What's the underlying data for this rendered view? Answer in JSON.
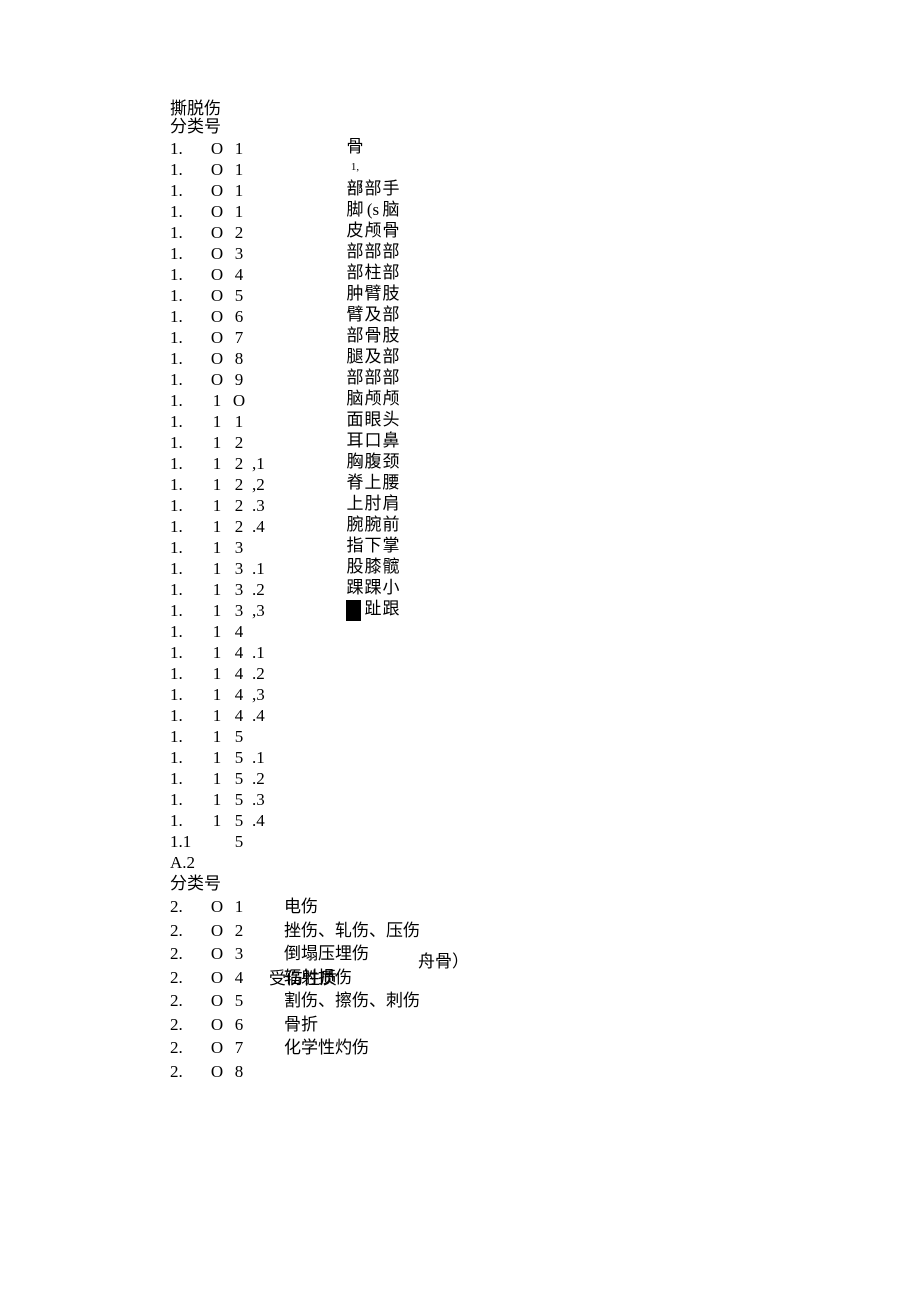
{
  "top": {
    "l1": "撕脱伤",
    "l2": "分类号"
  },
  "rows1": [
    {
      "a": "1.",
      "b": "O",
      "c": "1",
      "d": ""
    },
    {
      "a": "1.",
      "b": "O",
      "c": "1",
      "d": ""
    },
    {
      "a": "1.",
      "b": "O",
      "c": "1",
      "d": ""
    },
    {
      "a": "1.",
      "b": "O",
      "c": "1",
      "d": ""
    },
    {
      "a": "1.",
      "b": "O",
      "c": "2",
      "d": ""
    },
    {
      "a": "1.",
      "b": "O",
      "c": "3",
      "d": ""
    },
    {
      "a": "1.",
      "b": "O",
      "c": "4",
      "d": ""
    },
    {
      "a": "1.",
      "b": "O",
      "c": "5",
      "d": ""
    },
    {
      "a": "1.",
      "b": "O",
      "c": "6",
      "d": ""
    },
    {
      "a": "1.",
      "b": "O",
      "c": "7",
      "d": ""
    },
    {
      "a": "1.",
      "b": "O",
      "c": "8",
      "d": ""
    },
    {
      "a": "1.",
      "b": "O",
      "c": "9",
      "d": ""
    },
    {
      "a": "1.",
      "b": "1",
      "c": "O",
      "d": ""
    },
    {
      "a": "1.",
      "b": "1",
      "c": "1",
      "d": ""
    },
    {
      "a": "1.",
      "b": "1",
      "c": "2",
      "d": ""
    },
    {
      "a": "1.",
      "b": "1",
      "c": "2",
      "d": ",1"
    },
    {
      "a": "1.",
      "b": "1",
      "c": "2",
      "d": ",2"
    },
    {
      "a": "1.",
      "b": "1",
      "c": "2",
      "d": ".3"
    },
    {
      "a": "1.",
      "b": "1",
      "c": "2",
      "d": ".4"
    },
    {
      "a": "1.",
      "b": "1",
      "c": "3",
      "d": ""
    },
    {
      "a": "1.",
      "b": "1",
      "c": "3",
      "d": ".1"
    },
    {
      "a": "1.",
      "b": "1",
      "c": "3",
      "d": ".2"
    },
    {
      "a": "1.",
      "b": "1",
      "c": "3",
      "d": ",3"
    },
    {
      "a": "1.",
      "b": "1",
      "c": "4",
      "d": ""
    },
    {
      "a": "1.",
      "b": "1",
      "c": "4",
      "d": ".1"
    },
    {
      "a": "1.",
      "b": "1",
      "c": "4",
      "d": ".2"
    },
    {
      "a": "1.",
      "b": "1",
      "c": "4",
      "d": ",3"
    },
    {
      "a": "1.",
      "b": "1",
      "c": "4",
      "d": ".4"
    },
    {
      "a": "1.",
      "b": "1",
      "c": "5",
      "d": ""
    },
    {
      "a": "1.",
      "b": "1",
      "c": "5",
      "d": ".1"
    },
    {
      "a": "1.",
      "b": "1",
      "c": "5",
      "d": ".2"
    },
    {
      "a": "1.",
      "b": "1",
      "c": "5",
      "d": ".3"
    },
    {
      "a": "1.",
      "b": "1",
      "c": "5",
      "d": ".4"
    },
    {
      "a": "1.1",
      "b": "",
      "c": "5",
      "d": ""
    }
  ],
  "vcolA": [
    "骨",
    "1, 1' ?",
    "部",
    "脚",
    "皮",
    "部",
    "部",
    "肿",
    "臂",
    "部",
    "腿",
    "部",
    "脑",
    "面",
    "耳",
    "胸",
    "脊",
    "上",
    "腕",
    "指",
    "股",
    "踝",
    "■"
  ],
  "vcolB": [
    "",
    "",
    "部",
    "(s",
    "颅",
    "部",
    "柱",
    "臂",
    "及",
    "骨",
    "及",
    "部",
    "颅",
    "眼",
    "口",
    "腹",
    "上",
    "肘",
    "腕",
    "下",
    "膝",
    "踝",
    "趾"
  ],
  "vcolC": [
    "",
    "",
    "手",
    "脑",
    "骨",
    "部",
    "部",
    "肢",
    "部",
    "肢",
    "部",
    "部",
    "颅",
    "头",
    "鼻",
    "颈",
    "腰",
    "肩",
    "前",
    "掌",
    "髋",
    "小",
    "跟"
  ],
  "shouwu": "受伤性质",
  "zhougu": "舟骨）",
  "a2": "A.2",
  "fenleihao2": "分类号",
  "rows2": [
    {
      "a": "2.",
      "b": "O",
      "c": "1",
      "lbl": "电伤"
    },
    {
      "a": "2.",
      "b": "O",
      "c": "2",
      "lbl": "挫伤、轧伤、压伤"
    },
    {
      "a": "2.",
      "b": "O",
      "c": "3",
      "lbl": "倒塌压埋伤"
    },
    {
      "a": "2.",
      "b": "O",
      "c": "4",
      "lbl": "辐射损伤"
    },
    {
      "a": "2.",
      "b": "O",
      "c": "5",
      "lbl": "割伤、擦伤、刺伤"
    },
    {
      "a": "2.",
      "b": "O",
      "c": "6",
      "lbl": "骨折"
    },
    {
      "a": "2.",
      "b": "O",
      "c": "7",
      "lbl": "化学性灼伤"
    },
    {
      "a": "2.",
      "b": "O",
      "c": "8",
      "lbl": ""
    }
  ]
}
